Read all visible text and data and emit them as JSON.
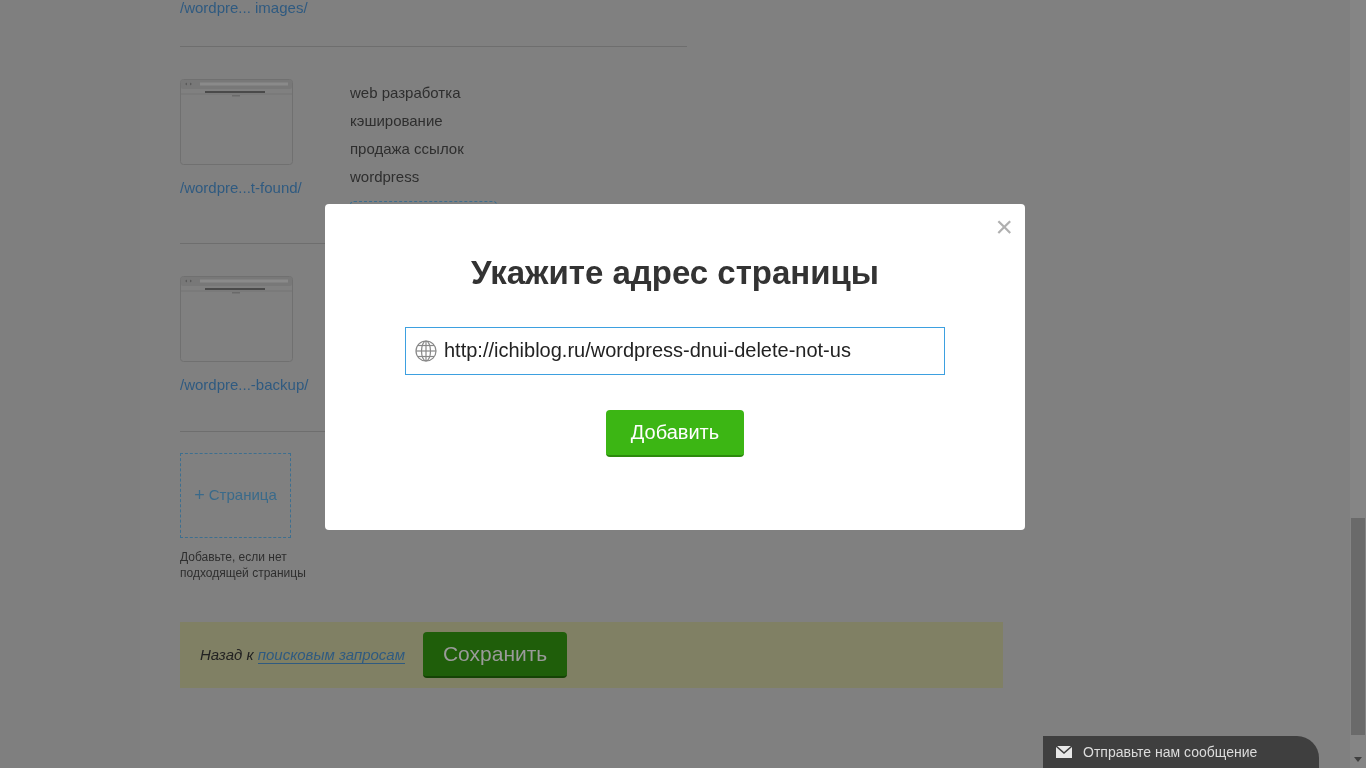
{
  "top_link": "/wordpre... images/",
  "pages": [
    {
      "link": "/wordpre...t-found/",
      "tags": [
        "web разработка",
        "кэширование",
        "продажа ссылок",
        "wordpress"
      ]
    },
    {
      "link": "/wordpre...-backup/"
    }
  ],
  "add_page": {
    "plus": "+",
    "label": "Страница",
    "hint": "Добавьте, если нет подходящей страницы"
  },
  "footer": {
    "back_text": "Назад к",
    "back_link": "поисковым запросам",
    "save_button": "Сохранить"
  },
  "modal": {
    "close": "×",
    "title": "Укажите адрес страницы",
    "url_value": "http://ichiblog.ru/wordpress-dnui-delete-not-us",
    "add_button": "Добавить"
  },
  "chat": {
    "label": "Отправьте нам сообщение"
  }
}
